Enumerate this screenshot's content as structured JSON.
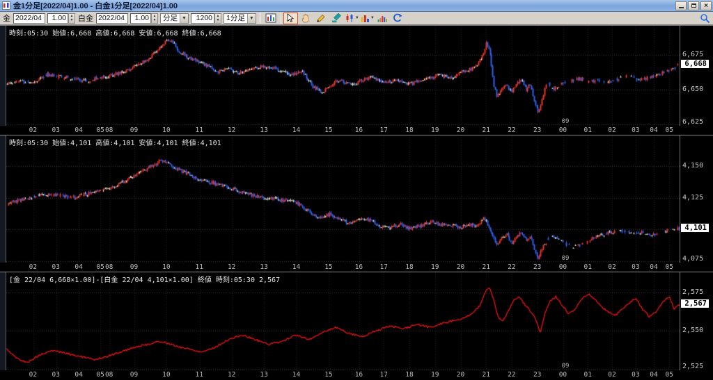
{
  "window": {
    "title": "金1分足[2022/04]1.00 - 白金1分足[2022/04]1.00"
  },
  "toolbar": {
    "gold_label": "金",
    "gold_month": "2022/04",
    "gold_multiplier": "1.00",
    "platinum_label": "白金",
    "platinum_month": "2022/04",
    "platinum_multiplier": "1.00",
    "bar_type": "分足",
    "bar_count": "1200",
    "period": "1分足",
    "icons": [
      "chart-window",
      "select-arrow",
      "pan-hand",
      "pencil",
      "marker",
      "candle-chart",
      "bar-chart",
      "histogram",
      "refresh"
    ],
    "active_icon": "select-arrow",
    "magnifier": "magnifier"
  },
  "x_axis": {
    "labels": [
      {
        "t": "02",
        "f": 0.04
      },
      {
        "t": "03",
        "f": 0.074
      },
      {
        "t": "04",
        "f": 0.108
      },
      {
        "t": "05",
        "f": 0.14
      },
      {
        "t": "08",
        "f": 0.153
      },
      {
        "t": "09",
        "f": 0.19
      },
      {
        "t": "10",
        "f": 0.238
      },
      {
        "t": "11",
        "f": 0.287
      },
      {
        "t": "12",
        "f": 0.335
      },
      {
        "t": "13",
        "f": 0.383
      },
      {
        "t": "14",
        "f": 0.431
      },
      {
        "t": "15",
        "f": 0.479
      },
      {
        "t": "16",
        "f": 0.524
      },
      {
        "t": "17",
        "f": 0.561
      },
      {
        "t": "18",
        "f": 0.599
      },
      {
        "t": "19",
        "f": 0.637
      },
      {
        "t": "20",
        "f": 0.675
      },
      {
        "t": "21",
        "f": 0.713
      },
      {
        "t": "22",
        "f": 0.751
      },
      {
        "t": "23",
        "f": 0.789
      },
      {
        "t": "00",
        "f": 0.827
      },
      {
        "t": "01",
        "f": 0.864
      },
      {
        "t": "02",
        "f": 0.9
      },
      {
        "t": "03",
        "f": 0.935
      },
      {
        "t": "04",
        "f": 0.962
      },
      {
        "t": "05",
        "f": 0.985
      }
    ],
    "date_marker": {
      "t": "09",
      "f": 0.83
    }
  },
  "chart_data": [
    {
      "type": "candle",
      "name": "gold-1min",
      "info": "時刻:05:30 始値:6,668 高値:6,668 安値:6,668 終値:6,668",
      "badge": "6,668",
      "badge_value": 6668,
      "range": [
        6624,
        6696
      ],
      "ticks": [
        {
          "label": "6,675",
          "value": 6675
        },
        {
          "label": "6,650",
          "value": 6650
        },
        {
          "label": "6,625",
          "value": 6625
        }
      ],
      "grid": [
        6675,
        6650,
        6625
      ],
      "noise": 1.3,
      "seed": 11,
      "bars": 520,
      "colors": {
        "up": "#f03428",
        "down": "#2f62ef",
        "flat": "#ddddcc"
      },
      "anchors": [
        [
          0.0,
          6654
        ],
        [
          0.02,
          6656
        ],
        [
          0.04,
          6655
        ],
        [
          0.06,
          6661
        ],
        [
          0.08,
          6659
        ],
        [
          0.1,
          6658
        ],
        [
          0.12,
          6656
        ],
        [
          0.14,
          6659
        ],
        [
          0.155,
          6660
        ],
        [
          0.175,
          6663
        ],
        [
          0.195,
          6668
        ],
        [
          0.215,
          6674
        ],
        [
          0.235,
          6684
        ],
        [
          0.245,
          6686
        ],
        [
          0.255,
          6678
        ],
        [
          0.27,
          6673
        ],
        [
          0.285,
          6670
        ],
        [
          0.3,
          6667
        ],
        [
          0.315,
          6663
        ],
        [
          0.33,
          6665
        ],
        [
          0.345,
          6662
        ],
        [
          0.36,
          6664
        ],
        [
          0.38,
          6667
        ],
        [
          0.4,
          6665
        ],
        [
          0.42,
          6661
        ],
        [
          0.44,
          6663
        ],
        [
          0.455,
          6652
        ],
        [
          0.47,
          6648
        ],
        [
          0.48,
          6653
        ],
        [
          0.495,
          6657
        ],
        [
          0.51,
          6653
        ],
        [
          0.525,
          6656
        ],
        [
          0.54,
          6659
        ],
        [
          0.56,
          6655
        ],
        [
          0.58,
          6657
        ],
        [
          0.6,
          6654
        ],
        [
          0.62,
          6658
        ],
        [
          0.64,
          6660
        ],
        [
          0.66,
          6659
        ],
        [
          0.68,
          6663
        ],
        [
          0.695,
          6666
        ],
        [
          0.705,
          6672
        ],
        [
          0.713,
          6684
        ],
        [
          0.718,
          6676
        ],
        [
          0.723,
          6655
        ],
        [
          0.728,
          6645
        ],
        [
          0.735,
          6650
        ],
        [
          0.742,
          6654
        ],
        [
          0.75,
          6648
        ],
        [
          0.758,
          6654
        ],
        [
          0.765,
          6657
        ],
        [
          0.772,
          6650
        ],
        [
          0.778,
          6654
        ],
        [
          0.784,
          6640
        ],
        [
          0.79,
          6634
        ],
        [
          0.796,
          6644
        ],
        [
          0.802,
          6656
        ],
        [
          0.81,
          6650
        ],
        [
          0.82,
          6653
        ],
        [
          0.835,
          6656
        ],
        [
          0.85,
          6658
        ],
        [
          0.865,
          6655
        ],
        [
          0.88,
          6657
        ],
        [
          0.895,
          6655
        ],
        [
          0.91,
          6658
        ],
        [
          0.925,
          6660
        ],
        [
          0.94,
          6657
        ],
        [
          0.955,
          6659
        ],
        [
          0.97,
          6661
        ],
        [
          0.985,
          6664
        ],
        [
          1.0,
          6668
        ]
      ]
    },
    {
      "type": "candle",
      "name": "platinum-1min",
      "info": "時刻:05:30 始値:4,101 高値:4,101 安値:4,101 終値:4,101",
      "badge": "4,101",
      "badge_value": 4101,
      "range": [
        4074,
        4174
      ],
      "ticks": [
        {
          "label": "4,150",
          "value": 4150
        },
        {
          "label": "4,125",
          "value": 4125
        },
        {
          "label": "4,075",
          "value": 4075
        }
      ],
      "grid": [
        4150,
        4125,
        4100,
        4075
      ],
      "noise": 1.4,
      "seed": 23,
      "bars": 520,
      "colors": {
        "up": "#f03428",
        "down": "#2f62ef",
        "flat": "#ddddcc"
      },
      "anchors": [
        [
          0.0,
          4120
        ],
        [
          0.02,
          4123
        ],
        [
          0.04,
          4126
        ],
        [
          0.06,
          4128
        ],
        [
          0.08,
          4127
        ],
        [
          0.1,
          4125
        ],
        [
          0.12,
          4128
        ],
        [
          0.14,
          4131
        ],
        [
          0.155,
          4133
        ],
        [
          0.175,
          4138
        ],
        [
          0.195,
          4144
        ],
        [
          0.215,
          4150
        ],
        [
          0.23,
          4154
        ],
        [
          0.245,
          4150
        ],
        [
          0.26,
          4146
        ],
        [
          0.275,
          4142
        ],
        [
          0.29,
          4139
        ],
        [
          0.31,
          4136
        ],
        [
          0.33,
          4133
        ],
        [
          0.35,
          4129
        ],
        [
          0.37,
          4126
        ],
        [
          0.39,
          4125
        ],
        [
          0.41,
          4123
        ],
        [
          0.43,
          4121
        ],
        [
          0.45,
          4114
        ],
        [
          0.465,
          4109
        ],
        [
          0.48,
          4112
        ],
        [
          0.495,
          4108
        ],
        [
          0.51,
          4105
        ],
        [
          0.525,
          4109
        ],
        [
          0.54,
          4107
        ],
        [
          0.555,
          4103
        ],
        [
          0.57,
          4102
        ],
        [
          0.585,
          4104
        ],
        [
          0.6,
          4101
        ],
        [
          0.615,
          4103
        ],
        [
          0.63,
          4106
        ],
        [
          0.645,
          4104
        ],
        [
          0.66,
          4103
        ],
        [
          0.675,
          4102
        ],
        [
          0.69,
          4104
        ],
        [
          0.7,
          4103
        ],
        [
          0.708,
          4109
        ],
        [
          0.715,
          4104
        ],
        [
          0.722,
          4094
        ],
        [
          0.728,
          4088
        ],
        [
          0.735,
          4093
        ],
        [
          0.742,
          4097
        ],
        [
          0.75,
          4089
        ],
        [
          0.758,
          4095
        ],
        [
          0.765,
          4098
        ],
        [
          0.772,
          4092
        ],
        [
          0.778,
          4095
        ],
        [
          0.784,
          4083
        ],
        [
          0.79,
          4077
        ],
        [
          0.796,
          4086
        ],
        [
          0.803,
          4092
        ],
        [
          0.812,
          4095
        ],
        [
          0.825,
          4090
        ],
        [
          0.84,
          4086
        ],
        [
          0.855,
          4089
        ],
        [
          0.87,
          4093
        ],
        [
          0.885,
          4096
        ],
        [
          0.9,
          4098
        ],
        [
          0.915,
          4099
        ],
        [
          0.93,
          4097
        ],
        [
          0.945,
          4098
        ],
        [
          0.96,
          4096
        ],
        [
          0.975,
          4099
        ],
        [
          0.99,
          4100
        ],
        [
          1.0,
          4101
        ]
      ]
    },
    {
      "type": "line",
      "name": "gold-platinum-spread",
      "info": "[金 22/04 6,668×1.00]-[白金 22/04 4,101×1.00] 終値 時刻:05:30 2,567",
      "badge": "2,567",
      "badge_value": 2567,
      "range": [
        2524,
        2588
      ],
      "ticks": [
        {
          "label": "2,575",
          "value": 2575
        },
        {
          "label": "2,550",
          "value": 2550
        },
        {
          "label": "2,525",
          "value": 2525
        }
      ],
      "grid": [
        2575,
        2550,
        2525
      ],
      "color": "#ee1515",
      "seed": 5,
      "anchors": [
        [
          0.0,
          2538
        ],
        [
          0.015,
          2532
        ],
        [
          0.03,
          2529
        ],
        [
          0.05,
          2534
        ],
        [
          0.07,
          2537
        ],
        [
          0.09,
          2535
        ],
        [
          0.11,
          2533
        ],
        [
          0.13,
          2531
        ],
        [
          0.15,
          2533
        ],
        [
          0.17,
          2536
        ],
        [
          0.19,
          2539
        ],
        [
          0.21,
          2541
        ],
        [
          0.23,
          2543
        ],
        [
          0.25,
          2540
        ],
        [
          0.27,
          2538
        ],
        [
          0.29,
          2536
        ],
        [
          0.31,
          2539
        ],
        [
          0.33,
          2544
        ],
        [
          0.35,
          2547
        ],
        [
          0.37,
          2544
        ],
        [
          0.39,
          2541
        ],
        [
          0.41,
          2543
        ],
        [
          0.43,
          2547
        ],
        [
          0.45,
          2544
        ],
        [
          0.47,
          2549
        ],
        [
          0.49,
          2552
        ],
        [
          0.51,
          2548
        ],
        [
          0.53,
          2546
        ],
        [
          0.55,
          2550
        ],
        [
          0.57,
          2553
        ],
        [
          0.59,
          2551
        ],
        [
          0.61,
          2554
        ],
        [
          0.63,
          2552
        ],
        [
          0.65,
          2555
        ],
        [
          0.67,
          2557
        ],
        [
          0.69,
          2560
        ],
        [
          0.703,
          2566
        ],
        [
          0.712,
          2576
        ],
        [
          0.718,
          2578
        ],
        [
          0.724,
          2570
        ],
        [
          0.73,
          2559
        ],
        [
          0.738,
          2556
        ],
        [
          0.746,
          2563
        ],
        [
          0.754,
          2570
        ],
        [
          0.762,
          2572
        ],
        [
          0.77,
          2567
        ],
        [
          0.778,
          2563
        ],
        [
          0.786,
          2558
        ],
        [
          0.793,
          2548
        ],
        [
          0.8,
          2561
        ],
        [
          0.808,
          2569
        ],
        [
          0.816,
          2572
        ],
        [
          0.825,
          2567
        ],
        [
          0.835,
          2561
        ],
        [
          0.845,
          2564
        ],
        [
          0.855,
          2571
        ],
        [
          0.865,
          2574
        ],
        [
          0.875,
          2570
        ],
        [
          0.885,
          2565
        ],
        [
          0.895,
          2562
        ],
        [
          0.905,
          2560
        ],
        [
          0.915,
          2564
        ],
        [
          0.925,
          2568
        ],
        [
          0.935,
          2571
        ],
        [
          0.945,
          2564
        ],
        [
          0.955,
          2559
        ],
        [
          0.965,
          2562
        ],
        [
          0.975,
          2569
        ],
        [
          0.985,
          2572
        ],
        [
          0.992,
          2564
        ],
        [
          1.0,
          2567
        ]
      ]
    }
  ]
}
